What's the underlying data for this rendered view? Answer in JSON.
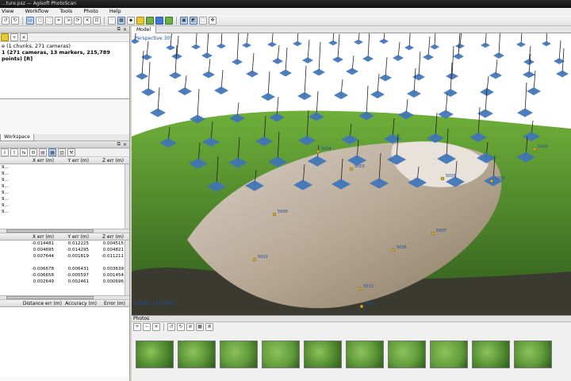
{
  "window": {
    "title": "...ture.psz — Agisoft PhotoScan"
  },
  "menu": [
    "View",
    "Workflow",
    "Tools",
    "Photo",
    "Help"
  ],
  "workspace": {
    "tree_line1": "e (1 chunks, 271 cameras)",
    "tree_line2": "1 (271 cameras, 13 markers, 215,789 points) [R]",
    "tab": "Workspace"
  },
  "reference_cameras": {
    "headers": [
      "",
      "X err (m)",
      "Y err (m)",
      "Z err (m)"
    ],
    "rows": [
      "9...",
      "9...",
      "9...",
      "9...",
      "9...",
      "9...",
      "9...",
      "9..."
    ]
  },
  "reference_markers": {
    "headers": [
      "",
      "X err (m)",
      "Y err (m)",
      "Z err (m)"
    ],
    "rows": [
      [
        "",
        "-0.014481",
        "0.012225",
        "0.004515"
      ],
      [
        "",
        "0.004695",
        "-0.014295",
        "0.004821"
      ],
      [
        "",
        "0.007644",
        "-0.001819",
        "-0.011211"
      ],
      [
        "",
        "",
        "",
        ""
      ],
      [
        "",
        "-0.006678",
        "0.006431",
        "0.003639"
      ],
      [
        "",
        "-0.006658",
        "-0.005597",
        "0.001454"
      ],
      [
        "",
        "0.002649",
        "0.002461",
        "0.000696"
      ]
    ]
  },
  "scalebars": {
    "headers": [
      "",
      "Distance err (m)",
      "Accuracy (m)",
      "Error (m)"
    ]
  },
  "viewer": {
    "tab": "Model",
    "perspective": "Perspective 30°",
    "points_label": "points: 215,789",
    "markers": [
      "5009",
      "5006",
      "5005",
      "5007",
      "5008",
      "5011",
      "5003",
      "5002",
      "5004",
      "5010",
      "5001"
    ],
    "colors": {
      "sky": "#ffffff",
      "camera": "#3e74b8",
      "terrain": "#b9aa96",
      "vegetation": "#4f8a2c",
      "marker": "#e0b020"
    }
  },
  "photos": {
    "title": "Photos",
    "thumb_color": "#5f9a3a"
  }
}
